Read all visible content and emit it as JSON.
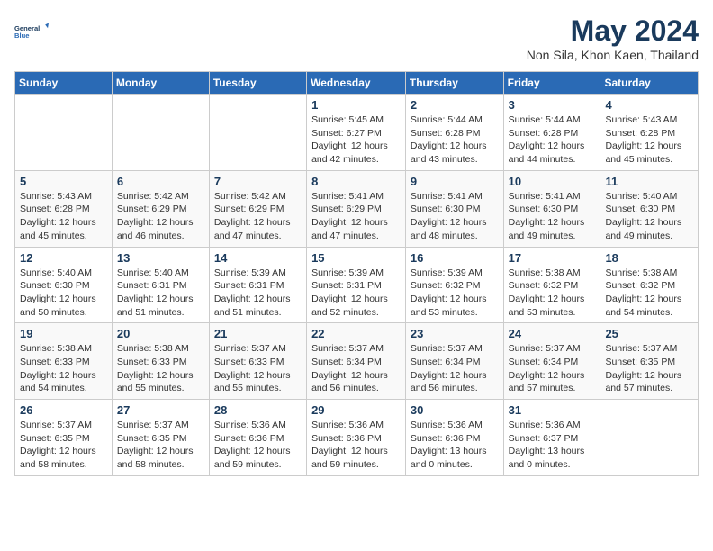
{
  "logo": {
    "line1": "General",
    "line2": "Blue"
  },
  "title": "May 2024",
  "location": "Non Sila, Khon Kaen, Thailand",
  "weekdays": [
    "Sunday",
    "Monday",
    "Tuesday",
    "Wednesday",
    "Thursday",
    "Friday",
    "Saturday"
  ],
  "weeks": [
    [
      {
        "day": "",
        "info": ""
      },
      {
        "day": "",
        "info": ""
      },
      {
        "day": "",
        "info": ""
      },
      {
        "day": "1",
        "info": "Sunrise: 5:45 AM\nSunset: 6:27 PM\nDaylight: 12 hours\nand 42 minutes."
      },
      {
        "day": "2",
        "info": "Sunrise: 5:44 AM\nSunset: 6:28 PM\nDaylight: 12 hours\nand 43 minutes."
      },
      {
        "day": "3",
        "info": "Sunrise: 5:44 AM\nSunset: 6:28 PM\nDaylight: 12 hours\nand 44 minutes."
      },
      {
        "day": "4",
        "info": "Sunrise: 5:43 AM\nSunset: 6:28 PM\nDaylight: 12 hours\nand 45 minutes."
      }
    ],
    [
      {
        "day": "5",
        "info": "Sunrise: 5:43 AM\nSunset: 6:28 PM\nDaylight: 12 hours\nand 45 minutes."
      },
      {
        "day": "6",
        "info": "Sunrise: 5:42 AM\nSunset: 6:29 PM\nDaylight: 12 hours\nand 46 minutes."
      },
      {
        "day": "7",
        "info": "Sunrise: 5:42 AM\nSunset: 6:29 PM\nDaylight: 12 hours\nand 47 minutes."
      },
      {
        "day": "8",
        "info": "Sunrise: 5:41 AM\nSunset: 6:29 PM\nDaylight: 12 hours\nand 47 minutes."
      },
      {
        "day": "9",
        "info": "Sunrise: 5:41 AM\nSunset: 6:30 PM\nDaylight: 12 hours\nand 48 minutes."
      },
      {
        "day": "10",
        "info": "Sunrise: 5:41 AM\nSunset: 6:30 PM\nDaylight: 12 hours\nand 49 minutes."
      },
      {
        "day": "11",
        "info": "Sunrise: 5:40 AM\nSunset: 6:30 PM\nDaylight: 12 hours\nand 49 minutes."
      }
    ],
    [
      {
        "day": "12",
        "info": "Sunrise: 5:40 AM\nSunset: 6:30 PM\nDaylight: 12 hours\nand 50 minutes."
      },
      {
        "day": "13",
        "info": "Sunrise: 5:40 AM\nSunset: 6:31 PM\nDaylight: 12 hours\nand 51 minutes."
      },
      {
        "day": "14",
        "info": "Sunrise: 5:39 AM\nSunset: 6:31 PM\nDaylight: 12 hours\nand 51 minutes."
      },
      {
        "day": "15",
        "info": "Sunrise: 5:39 AM\nSunset: 6:31 PM\nDaylight: 12 hours\nand 52 minutes."
      },
      {
        "day": "16",
        "info": "Sunrise: 5:39 AM\nSunset: 6:32 PM\nDaylight: 12 hours\nand 53 minutes."
      },
      {
        "day": "17",
        "info": "Sunrise: 5:38 AM\nSunset: 6:32 PM\nDaylight: 12 hours\nand 53 minutes."
      },
      {
        "day": "18",
        "info": "Sunrise: 5:38 AM\nSunset: 6:32 PM\nDaylight: 12 hours\nand 54 minutes."
      }
    ],
    [
      {
        "day": "19",
        "info": "Sunrise: 5:38 AM\nSunset: 6:33 PM\nDaylight: 12 hours\nand 54 minutes."
      },
      {
        "day": "20",
        "info": "Sunrise: 5:38 AM\nSunset: 6:33 PM\nDaylight: 12 hours\nand 55 minutes."
      },
      {
        "day": "21",
        "info": "Sunrise: 5:37 AM\nSunset: 6:33 PM\nDaylight: 12 hours\nand 55 minutes."
      },
      {
        "day": "22",
        "info": "Sunrise: 5:37 AM\nSunset: 6:34 PM\nDaylight: 12 hours\nand 56 minutes."
      },
      {
        "day": "23",
        "info": "Sunrise: 5:37 AM\nSunset: 6:34 PM\nDaylight: 12 hours\nand 56 minutes."
      },
      {
        "day": "24",
        "info": "Sunrise: 5:37 AM\nSunset: 6:34 PM\nDaylight: 12 hours\nand 57 minutes."
      },
      {
        "day": "25",
        "info": "Sunrise: 5:37 AM\nSunset: 6:35 PM\nDaylight: 12 hours\nand 57 minutes."
      }
    ],
    [
      {
        "day": "26",
        "info": "Sunrise: 5:37 AM\nSunset: 6:35 PM\nDaylight: 12 hours\nand 58 minutes."
      },
      {
        "day": "27",
        "info": "Sunrise: 5:37 AM\nSunset: 6:35 PM\nDaylight: 12 hours\nand 58 minutes."
      },
      {
        "day": "28",
        "info": "Sunrise: 5:36 AM\nSunset: 6:36 PM\nDaylight: 12 hours\nand 59 minutes."
      },
      {
        "day": "29",
        "info": "Sunrise: 5:36 AM\nSunset: 6:36 PM\nDaylight: 12 hours\nand 59 minutes."
      },
      {
        "day": "30",
        "info": "Sunrise: 5:36 AM\nSunset: 6:36 PM\nDaylight: 13 hours\nand 0 minutes."
      },
      {
        "day": "31",
        "info": "Sunrise: 5:36 AM\nSunset: 6:37 PM\nDaylight: 13 hours\nand 0 minutes."
      },
      {
        "day": "",
        "info": ""
      }
    ]
  ]
}
